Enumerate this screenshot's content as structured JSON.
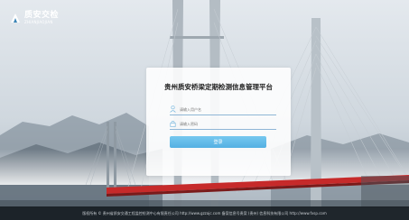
{
  "brand": {
    "name": "质安交检",
    "subtitle": "ZHIANJIAOJIAN"
  },
  "login": {
    "title": "贵州质安桥梁定期检测信息管理平台",
    "username_placeholder": "请输入用户名",
    "password_placeholder": "请输入密码",
    "submit_label": "登录"
  },
  "footer": {
    "text": "版权所有 © 贵州省质安交通工程监控检测中心有限责任公司 http://www.gzzajc.com 备案信息号贵案 (贵州) 信息科技有限公司 http://www.fxsp.com"
  },
  "colors": {
    "accent": "#5ab8e8",
    "bridge_red": "#c62a2a",
    "footer_bg": "#1b2127"
  }
}
